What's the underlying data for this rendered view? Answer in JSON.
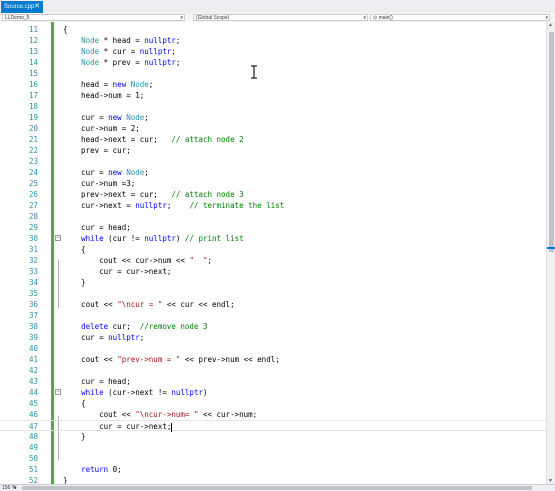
{
  "tab": {
    "title": "Source.cpp",
    "close": "✕"
  },
  "navbar": {
    "project": "LLDemo_5",
    "scope": "(Global Scope)",
    "member": "main()"
  },
  "lines": [
    {
      "num": "11",
      "tokens": [
        {
          "t": "{",
          "c": ""
        }
      ]
    },
    {
      "num": "12",
      "tokens": [
        {
          "t": "    ",
          "c": ""
        },
        {
          "t": "Node",
          "c": "type"
        },
        {
          "t": " * head = ",
          "c": ""
        },
        {
          "t": "nullptr",
          "c": "kw"
        },
        {
          "t": ";",
          "c": ""
        }
      ]
    },
    {
      "num": "13",
      "tokens": [
        {
          "t": "    ",
          "c": ""
        },
        {
          "t": "Node",
          "c": "type"
        },
        {
          "t": " * cur = ",
          "c": ""
        },
        {
          "t": "nullptr",
          "c": "kw"
        },
        {
          "t": ";",
          "c": ""
        }
      ]
    },
    {
      "num": "14",
      "tokens": [
        {
          "t": "    ",
          "c": ""
        },
        {
          "t": "Node",
          "c": "type"
        },
        {
          "t": " * prev = ",
          "c": ""
        },
        {
          "t": "nullptr",
          "c": "kw"
        },
        {
          "t": ";",
          "c": ""
        }
      ]
    },
    {
      "num": "15",
      "tokens": []
    },
    {
      "num": "16",
      "tokens": [
        {
          "t": "    head = ",
          "c": ""
        },
        {
          "t": "new",
          "c": "kw"
        },
        {
          "t": " ",
          "c": ""
        },
        {
          "t": "Node",
          "c": "type"
        },
        {
          "t": ";",
          "c": ""
        }
      ]
    },
    {
      "num": "17",
      "tokens": [
        {
          "t": "    head->num = 1;",
          "c": ""
        }
      ]
    },
    {
      "num": "18",
      "tokens": []
    },
    {
      "num": "19",
      "tokens": [
        {
          "t": "    cur = ",
          "c": ""
        },
        {
          "t": "new",
          "c": "kw"
        },
        {
          "t": " ",
          "c": ""
        },
        {
          "t": "Node",
          "c": "type"
        },
        {
          "t": ";",
          "c": ""
        }
      ]
    },
    {
      "num": "20",
      "tokens": [
        {
          "t": "    cur->num = 2;",
          "c": ""
        }
      ]
    },
    {
      "num": "21",
      "tokens": [
        {
          "t": "    head->next = cur;   ",
          "c": ""
        },
        {
          "t": "// attach node 2",
          "c": "com"
        }
      ]
    },
    {
      "num": "22",
      "tokens": [
        {
          "t": "    prev = cur;",
          "c": ""
        }
      ]
    },
    {
      "num": "23",
      "tokens": []
    },
    {
      "num": "24",
      "tokens": [
        {
          "t": "    cur = ",
          "c": ""
        },
        {
          "t": "new",
          "c": "kw"
        },
        {
          "t": " ",
          "c": ""
        },
        {
          "t": "Node",
          "c": "type"
        },
        {
          "t": ";",
          "c": ""
        }
      ]
    },
    {
      "num": "25",
      "tokens": [
        {
          "t": "    cur->num =3;",
          "c": ""
        }
      ]
    },
    {
      "num": "26",
      "tokens": [
        {
          "t": "    prev->next = cur;   ",
          "c": ""
        },
        {
          "t": "// attach node 3",
          "c": "com"
        }
      ]
    },
    {
      "num": "27",
      "tokens": [
        {
          "t": "    cur->next = ",
          "c": ""
        },
        {
          "t": "nullptr",
          "c": "kw"
        },
        {
          "t": ";    ",
          "c": ""
        },
        {
          "t": "// terminate the list",
          "c": "com"
        }
      ]
    },
    {
      "num": "28",
      "tokens": []
    },
    {
      "num": "29",
      "tokens": [
        {
          "t": "    cur = head;",
          "c": ""
        }
      ]
    },
    {
      "num": "30",
      "tokens": [
        {
          "t": "    ",
          "c": ""
        },
        {
          "t": "while",
          "c": "kw"
        },
        {
          "t": " (cur != ",
          "c": ""
        },
        {
          "t": "nullptr",
          "c": "kw"
        },
        {
          "t": ") ",
          "c": ""
        },
        {
          "t": "// print list",
          "c": "com"
        }
      ],
      "fold": "−"
    },
    {
      "num": "31",
      "tokens": [
        {
          "t": "    {",
          "c": ""
        }
      ]
    },
    {
      "num": "32",
      "tokens": [
        {
          "t": "        cout << cur->num << ",
          "c": ""
        },
        {
          "t": "\"  \"",
          "c": "str"
        },
        {
          "t": ";",
          "c": ""
        }
      ]
    },
    {
      "num": "33",
      "tokens": [
        {
          "t": "        cur = cur->next;",
          "c": ""
        }
      ]
    },
    {
      "num": "34",
      "tokens": [
        {
          "t": "    }",
          "c": ""
        }
      ]
    },
    {
      "num": "35",
      "tokens": []
    },
    {
      "num": "36",
      "tokens": [
        {
          "t": "    cout << ",
          "c": ""
        },
        {
          "t": "\"\\ncur = \"",
          "c": "str"
        },
        {
          "t": " << cur << endl;",
          "c": ""
        }
      ]
    },
    {
      "num": "37",
      "tokens": []
    },
    {
      "num": "38",
      "tokens": [
        {
          "t": "    ",
          "c": ""
        },
        {
          "t": "delete",
          "c": "kw"
        },
        {
          "t": " cur;  ",
          "c": ""
        },
        {
          "t": "//remove node 3",
          "c": "com"
        }
      ]
    },
    {
      "num": "39",
      "tokens": [
        {
          "t": "    cur = ",
          "c": ""
        },
        {
          "t": "nullptr",
          "c": "kw"
        },
        {
          "t": ";",
          "c": ""
        }
      ]
    },
    {
      "num": "40",
      "tokens": []
    },
    {
      "num": "41",
      "tokens": [
        {
          "t": "    cout << ",
          "c": ""
        },
        {
          "t": "\"prev->num = \"",
          "c": "str"
        },
        {
          "t": " << prev->num << endl;",
          "c": ""
        }
      ]
    },
    {
      "num": "42",
      "tokens": []
    },
    {
      "num": "43",
      "tokens": [
        {
          "t": "    cur = head;",
          "c": ""
        }
      ]
    },
    {
      "num": "44",
      "tokens": [
        {
          "t": "    ",
          "c": ""
        },
        {
          "t": "while",
          "c": "kw"
        },
        {
          "t": " (cur->next != ",
          "c": ""
        },
        {
          "t": "nullptr",
          "c": "kw"
        },
        {
          "t": ")",
          "c": ""
        }
      ],
      "fold": "−"
    },
    {
      "num": "45",
      "tokens": [
        {
          "t": "    {",
          "c": ""
        }
      ]
    },
    {
      "num": "46",
      "tokens": [
        {
          "t": "        cout << ",
          "c": ""
        },
        {
          "t": "\"\\ncur->num= \"",
          "c": "str"
        },
        {
          "t": " << cur->num;",
          "c": ""
        }
      ]
    },
    {
      "num": "47",
      "tokens": [
        {
          "t": "        cur = cur->next;",
          "c": ""
        }
      ],
      "current": true
    },
    {
      "num": "48",
      "tokens": [
        {
          "t": "    }",
          "c": ""
        }
      ]
    },
    {
      "num": "49",
      "tokens": []
    },
    {
      "num": "50",
      "tokens": []
    },
    {
      "num": "51",
      "tokens": [
        {
          "t": "    ",
          "c": ""
        },
        {
          "t": "return",
          "c": "kw"
        },
        {
          "t": " 0;",
          "c": ""
        }
      ]
    },
    {
      "num": "52",
      "tokens": [
        {
          "t": "}",
          "c": ""
        }
      ]
    }
  ],
  "statusbar": {
    "zoom": "156 %",
    "zoom_arrow": "▾"
  },
  "colors": {
    "accent": "#007acc",
    "type": "#2b91af",
    "keyword": "#0000ff",
    "string": "#a31515",
    "comment": "#008000"
  }
}
